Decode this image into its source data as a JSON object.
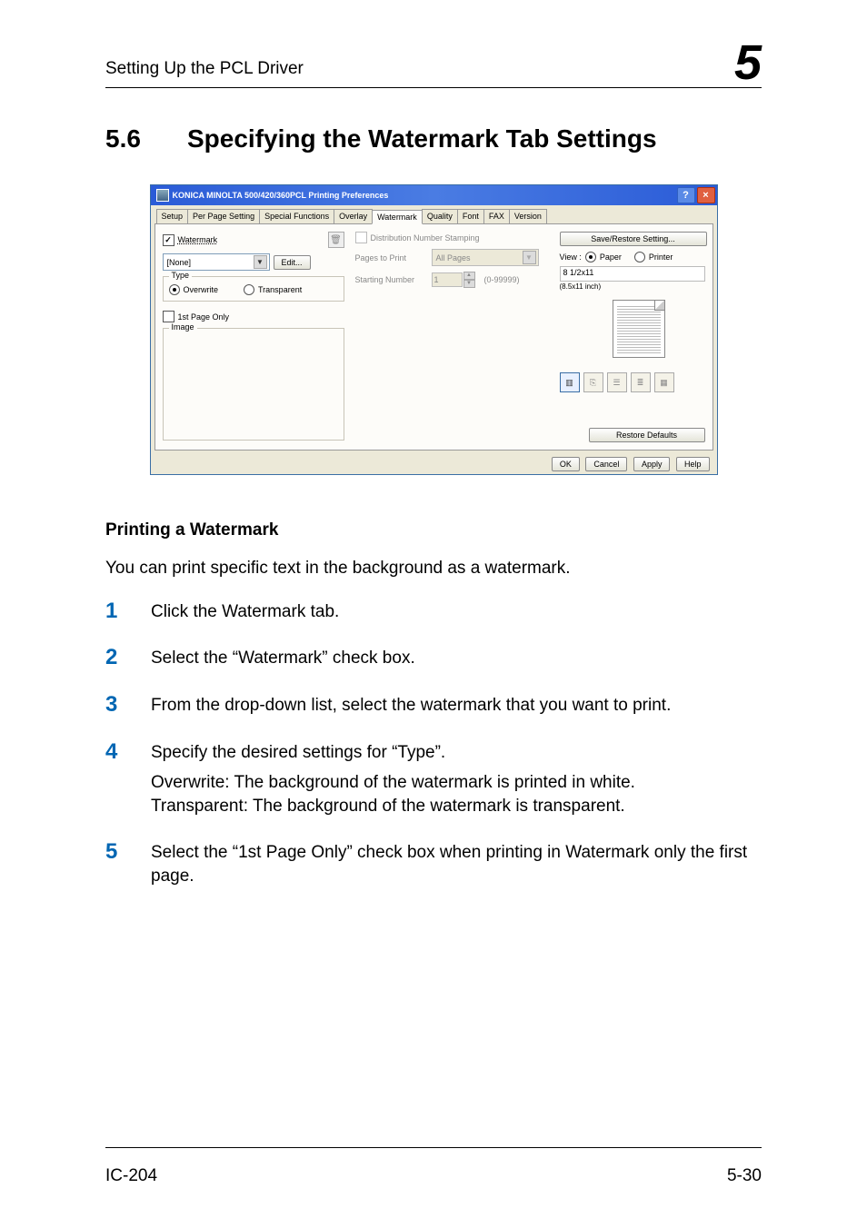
{
  "header": {
    "doc_section": "Setting Up the PCL Driver",
    "chapter_num": "5"
  },
  "section": {
    "num": "5.6",
    "title": "Specifying the Watermark Tab Settings"
  },
  "screenshot": {
    "title": "KONICA MINOLTA 500/420/360PCL Printing Preferences",
    "help_btn": "?",
    "close_btn": "×",
    "tabs": [
      "Setup",
      "Per Page Setting",
      "Special Functions",
      "Overlay",
      "Watermark",
      "Quality",
      "Font",
      "FAX",
      "Version"
    ],
    "active_tab_index": 4,
    "left": {
      "watermark_label": "Watermark",
      "dropdown_value": "[None]",
      "edit_btn": "Edit...",
      "type_legend": "Type",
      "overwrite_label": "Overwrite",
      "transparent_label": "Transparent",
      "first_page_label": "1st Page Only",
      "image_legend": "Image"
    },
    "mid": {
      "dist_label": "Distribution Number Stamping",
      "pages_label": "Pages to Print",
      "pages_value": "All Pages",
      "start_label": "Starting Number",
      "start_value": "1",
      "start_range": "(0-99999)"
    },
    "right": {
      "save_btn": "Save/Restore Setting...",
      "view_label": "View :",
      "view_paper": "Paper",
      "view_printer": "Printer",
      "paper_name": "8 1/2x11",
      "paper_dim": "(8.5x11 inch)",
      "restore_btn": "Restore Defaults"
    },
    "buttons": {
      "ok": "OK",
      "cancel": "Cancel",
      "apply": "Apply",
      "help": "Help"
    }
  },
  "content": {
    "subheading": "Printing a Watermark",
    "intro": "You can print specific text in the background as a watermark.",
    "steps": [
      {
        "n": "1",
        "text": "Click the Watermark tab."
      },
      {
        "n": "2",
        "text": "Select the “Watermark” check box."
      },
      {
        "n": "3",
        "text": "From the drop-down list, select the watermark that you want to print."
      },
      {
        "n": "4",
        "text": "Specify the desired settings for “Type”.",
        "sub": "Overwrite: The background of the watermark is printed in white.\nTransparent: The background of the watermark is transparent."
      },
      {
        "n": "5",
        "text": "Select the “1st Page Only” check box when printing in Watermark only the first page."
      }
    ]
  },
  "footer": {
    "left": "IC-204",
    "right": "5-30"
  }
}
